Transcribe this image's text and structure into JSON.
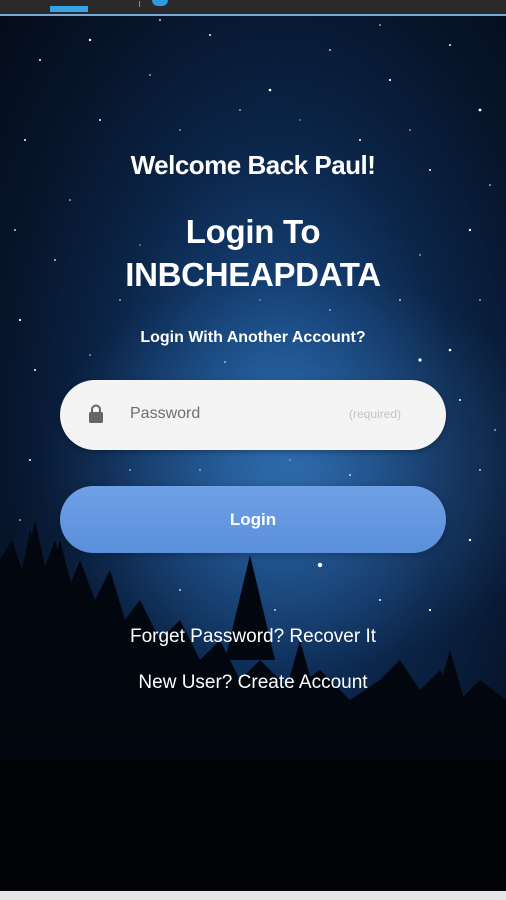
{
  "header": {
    "welcome": "Welcome Back Paul!",
    "title_line1": "Login To",
    "title_line2": "INBCHEAPDATA",
    "another_account": "Login With Another Account?"
  },
  "form": {
    "password_placeholder": "Password",
    "required_hint": "(required)",
    "lock_icon": "lock-icon",
    "login_label": "Login"
  },
  "links": {
    "forgot_password": "Forget Password? Recover It",
    "new_user": "New User? Create Account"
  },
  "colors": {
    "button": "#5f94df",
    "input_bg": "#f4f4f4",
    "sky_dark": "#030a16",
    "sky_mid": "#1f5b9a"
  }
}
